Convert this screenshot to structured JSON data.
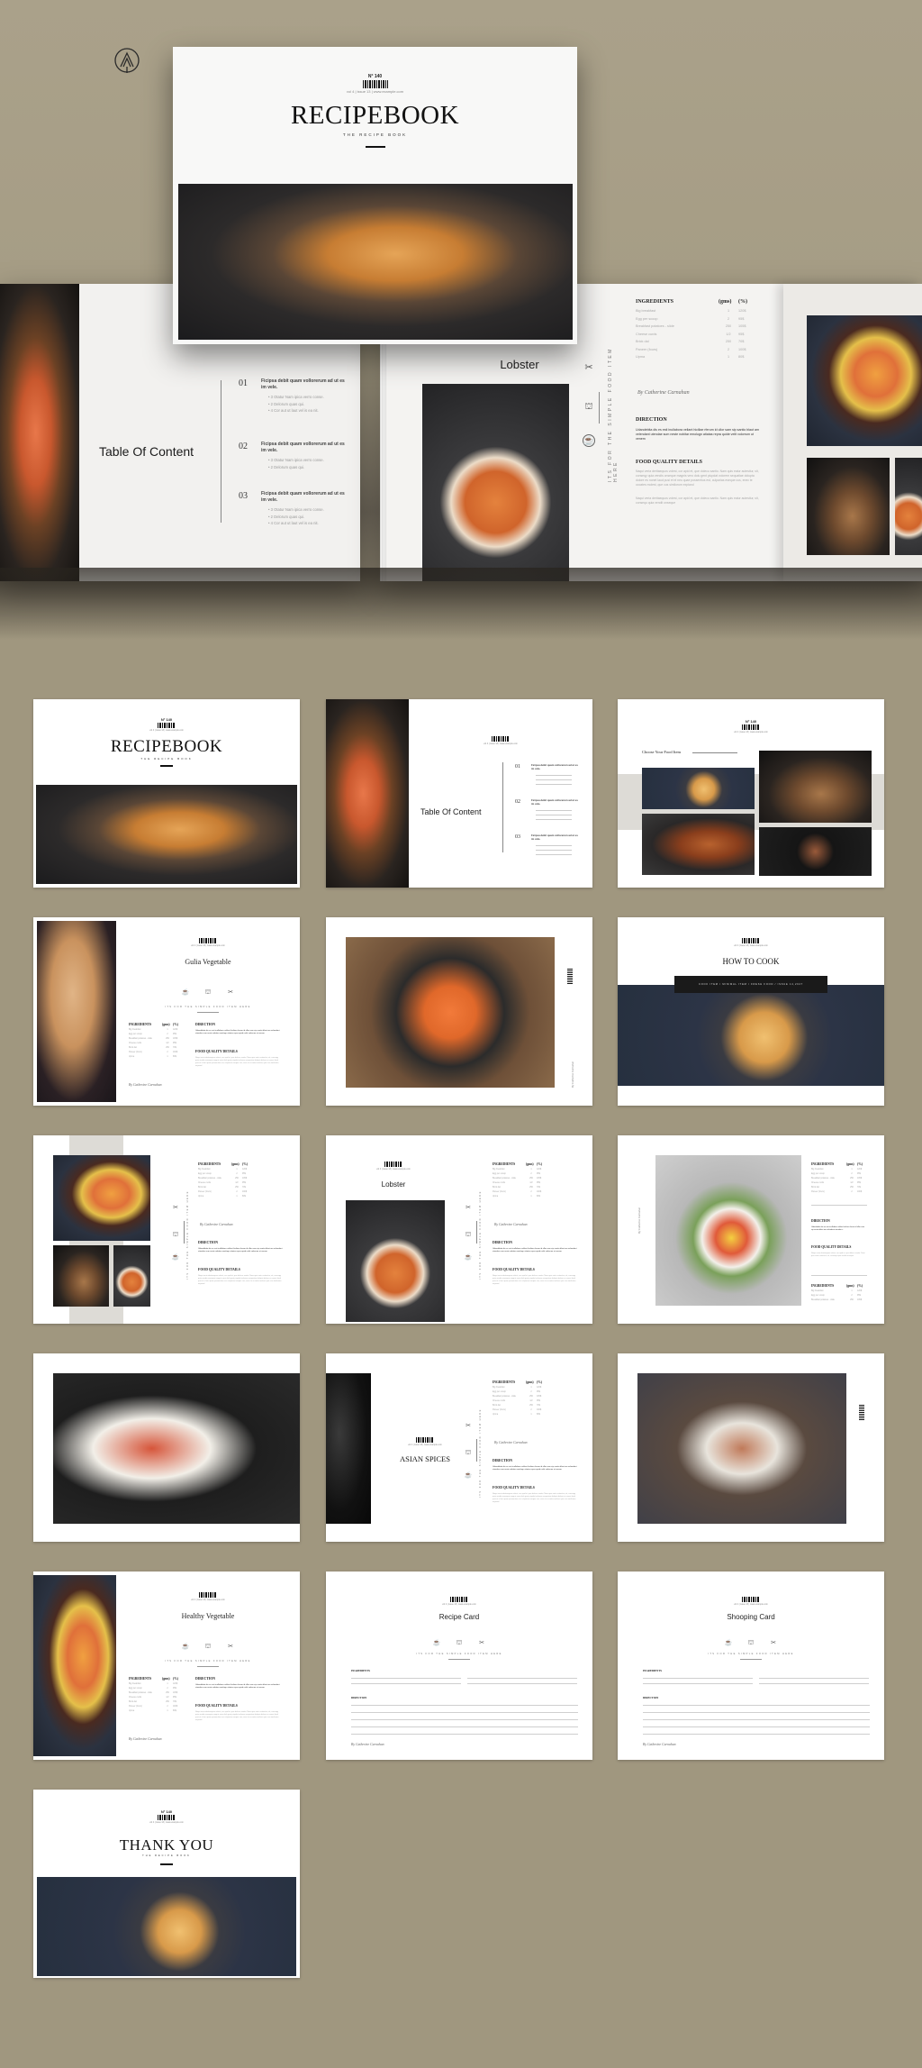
{
  "brand": {
    "logo_icon": "arrow-circle-logo-icon"
  },
  "hero": {
    "cover": {
      "issue_no": "N° 140",
      "issue_meta": "vol 4 | issue 13 | www.example.com",
      "title": "RECIPEBOOK",
      "subtitle": "THE RECIPE BOOK"
    },
    "left_spread": {
      "toc_title": "Table Of Content",
      "sections": [
        {
          "num": "01",
          "heading": "Ficipsa debit quam vollorerum ad ut es im vele.",
          "bullets": [
            "3 Otatur Nam ipica verro conse.",
            "2 Delorum quas qui.",
            "4 Cor aut ut laut vel is ea nit."
          ]
        },
        {
          "num": "02",
          "heading": "Ficipsa debit quam vollorerum ad ut es im vele.",
          "bullets": [
            "3 Otatur Nam ipica verro conse.",
            "2 Delorum quas qui."
          ]
        },
        {
          "num": "03",
          "heading": "Ficipsa debit quam vollorerum ad ut es im vele.",
          "bullets": [
            "3 Otatur Nam ipica verro conse.",
            "2 Delorum quas qui.",
            "4 Cor aut ut laut vel is ea nit."
          ]
        }
      ]
    },
    "right_spread": {
      "title": "Lobster",
      "vertical_tagline": "ITS FOR THE SIMPLE FOOD ITEM HERE",
      "ingredients": {
        "headers": [
          "INGREDIENTS",
          "(gms)",
          "(%)"
        ],
        "rows": [
          [
            "Big breakfast",
            "1",
            "120$"
          ],
          [
            "Egg per scoop",
            "2",
            "95$"
          ],
          [
            "Breakfast potatoes - slide",
            "250",
            "105$"
          ],
          [
            "Cheese curds",
            "1/2",
            "95$"
          ],
          [
            "Brick dal",
            "250",
            "70$"
          ],
          [
            "Paneer (fours)",
            "2",
            "100$"
          ],
          [
            "Upma",
            "1",
            "80$"
          ]
        ]
      },
      "signature": "By Catherine Carnahan",
      "direction_title": "DIRECTION",
      "direction_text": "Udandebita dis es esti inullabora vellant hiciliae rferum id ullor sam sip santio blaut am velendant utendae sum neste nobitar emolugn atiatas repra quide velit volorrum ut venem",
      "quality_title": "FOOD QUALITY DETAILS",
      "quality_text_1": "Naqui veria deritaequos volest, cor apid et, que dolecu santio. Nam quis eatur autestiur, sit, conseqy quia vendis onseque magnis vero dolu gent piupdat volorem sequatiae dolupta dolore es nonet laud pusi et el neu quae possentius est, culparias eseque cus, enec te occates molest, que cus similorum expiand",
      "quality_text_2": "Naqui veria deritaequos volest, cor apid et, que dolecu santio. Nam quis eatur autestiur, sit, consequ quia vendit onseque"
    }
  },
  "pages": [
    {
      "id": "cover",
      "issue_no": "N° 140",
      "issue_meta": "vol 4 | issue 13 | www.example.com",
      "title": "RECIPEBOOK",
      "subtitle": "THE RECIPE BOOK"
    },
    {
      "id": "toc",
      "issue_meta": "vol 4 | issue 13 | www.example.com",
      "title": "Table Of Content",
      "nums": [
        "01",
        "02",
        "03"
      ],
      "heading": "Ficipsa debit quam vollorerum ad ut es im vele."
    },
    {
      "id": "choose",
      "issue_no": "N° 140",
      "issue_meta": "vol 4 | issue 13 | www.example.com",
      "title": "Choose Your Food Item"
    },
    {
      "id": "gulia",
      "issue_meta": "vol 4 | issue 13 | www.example.com",
      "title": "Gulia Vegetable",
      "tagline": "ITS FOR THE SIMPLE FOOD ITEM HERE",
      "signature": "By Catherine Carnahan"
    },
    {
      "id": "pumpkin",
      "signature": "By Catherine Carnahan"
    },
    {
      "id": "howto",
      "issue_meta": "vol 4 | issue 13 | www.example.com",
      "title": "HOW TO COOK",
      "banner": "COOK ITEM / MINIMAL ITEM / FRESH FOOD / ISSUE 14,2027"
    },
    {
      "id": "collage",
      "tagline": "ITS FOR THE SIMPLE FOOD ITEM HERE",
      "signature": "By Catherine Carnahan"
    },
    {
      "id": "lobster",
      "issue_meta": "vol 4 | issue 13 | www.example.com",
      "title": "Lobster",
      "tagline": "ITS FOR THE SIMPLE FOOD ITEM HERE",
      "signature": "By Catherine Carnahan"
    },
    {
      "id": "breakfast",
      "signature": "By Catherine Carnahan"
    },
    {
      "id": "rice"
    },
    {
      "id": "asian",
      "issue_meta": "vol 4 | issue 13 | www.example.com",
      "title": "ASIAN SPICES",
      "tagline": "ITS FOR THE SIMPLE FOOD ITEM HERE",
      "signature": "By Catherine Carnahan"
    },
    {
      "id": "fig"
    },
    {
      "id": "healthy",
      "issue_meta": "vol 4 | issue 13 | www.example.com",
      "title": "Healthy Vegetable",
      "tagline": "ITS FOR THE SIMPLE FOOD ITEM HERE",
      "signature": "By Catherine Carnahan"
    },
    {
      "id": "recipe-card",
      "issue_meta": "vol 4 | issue 13 | www.example.com",
      "title": "Recipe Card",
      "tagline": "ITS FOR THE SIMPLE FOOD ITEM HERE",
      "ingredients_label": "INGREDIENTS",
      "direction_label": "DIRECTION",
      "signature": "By Catherine Carnahan"
    },
    {
      "id": "shopping-card",
      "issue_meta": "vol 4 | issue 13 | www.example.com",
      "title": "Shooping Card",
      "tagline": "ITS FOR THE SIMPLE FOOD ITEM HERE",
      "ingredients_label": "INGREDIENTS",
      "direction_label": "DIRECTION",
      "signature": "By Catherine Carnahan"
    },
    {
      "id": "thank-you",
      "issue_no": "N° 140",
      "issue_meta": "vol 4 | issue 13 | www.example.com",
      "title": "THANK YOU",
      "subtitle": "THE RECIPE BOOK"
    }
  ],
  "labels": {
    "ingredients": "INGREDIENTS",
    "gms": "(gms)",
    "pct": "(%)",
    "direction": "DIRECTION",
    "quality": "FOOD QUALITY DETAILS"
  },
  "colors": {
    "background": "#a0977f",
    "page": "#ffffff",
    "ink": "#111111",
    "band": "#dddbd6"
  }
}
